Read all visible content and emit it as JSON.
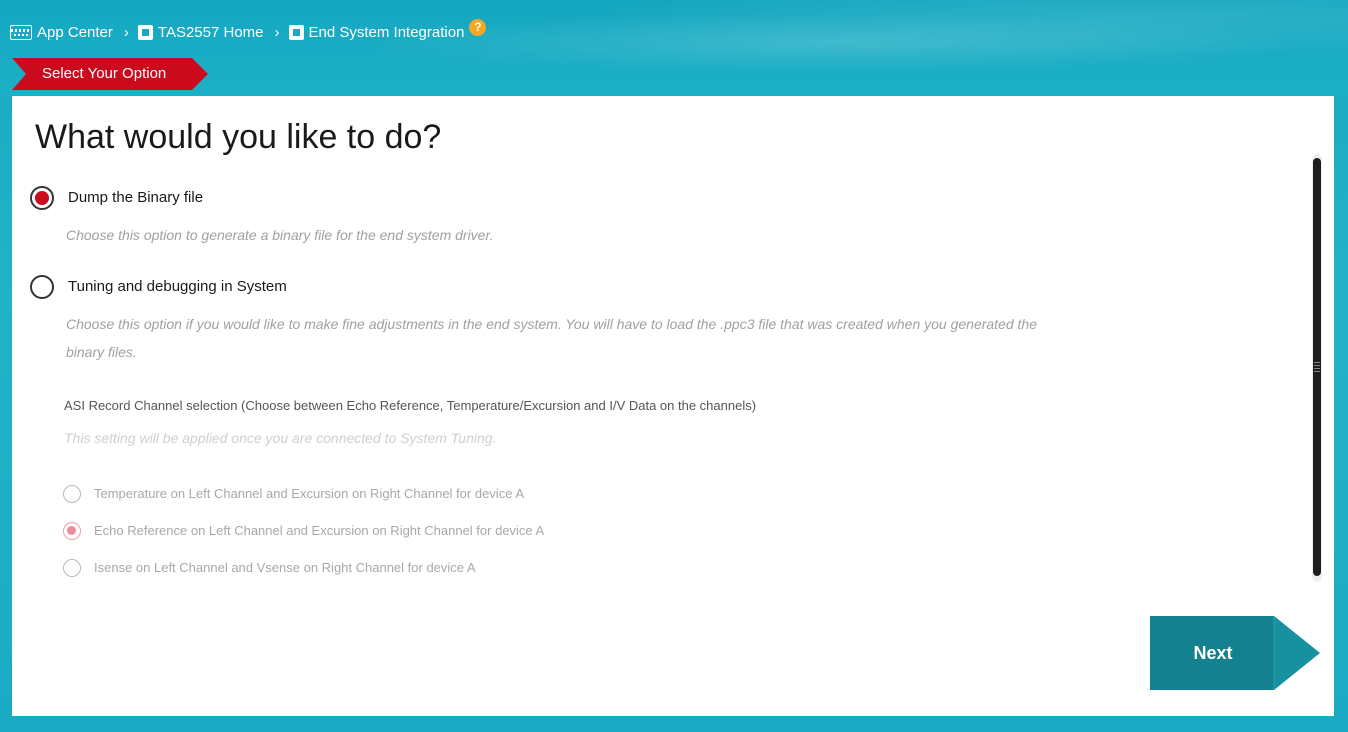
{
  "breadcrumb": {
    "items": [
      {
        "label": "App Center",
        "icon": "app-center-icon"
      },
      {
        "label": "TAS2557 Home",
        "icon": "chip-icon"
      },
      {
        "label": "End System Integration",
        "icon": "chip-icon"
      }
    ],
    "separator": "›",
    "help": "?"
  },
  "step": {
    "label": "Select Your Option"
  },
  "main": {
    "title": "What would you like to do?",
    "options": [
      {
        "label": "Dump the Binary file",
        "description": "Choose this option to generate a binary file for the end system driver.",
        "selected": true
      },
      {
        "label": "Tuning and debugging in System",
        "description_line1": "Choose this option if you would like to make fine adjustments in the end system. You will have to load the .ppc3 file that was created when you generated the",
        "description_line2": "binary files.",
        "selected": false
      }
    ],
    "asi": {
      "label": "ASI Record Channel selection (Choose between Echo Reference, Temperature/Excursion and I/V Data on the channels)",
      "note": "This setting will be applied once you are connected to System Tuning.",
      "choices": [
        {
          "label": "Temperature on Left Channel and Excursion on Right Channel for device A",
          "selected": false
        },
        {
          "label": "Echo Reference on Left Channel and Excursion on Right Channel for device A",
          "selected": true
        },
        {
          "label": "Isense on Left Channel and Vsense on Right Channel for device A",
          "selected": false
        }
      ]
    },
    "next_label": "Next"
  },
  "colors": {
    "header_bg": "#1aabc4",
    "accent_red": "#cc0a1e",
    "next_button": "#13818f",
    "next_arrow": "#17909f",
    "help_badge": "#f5a623"
  }
}
